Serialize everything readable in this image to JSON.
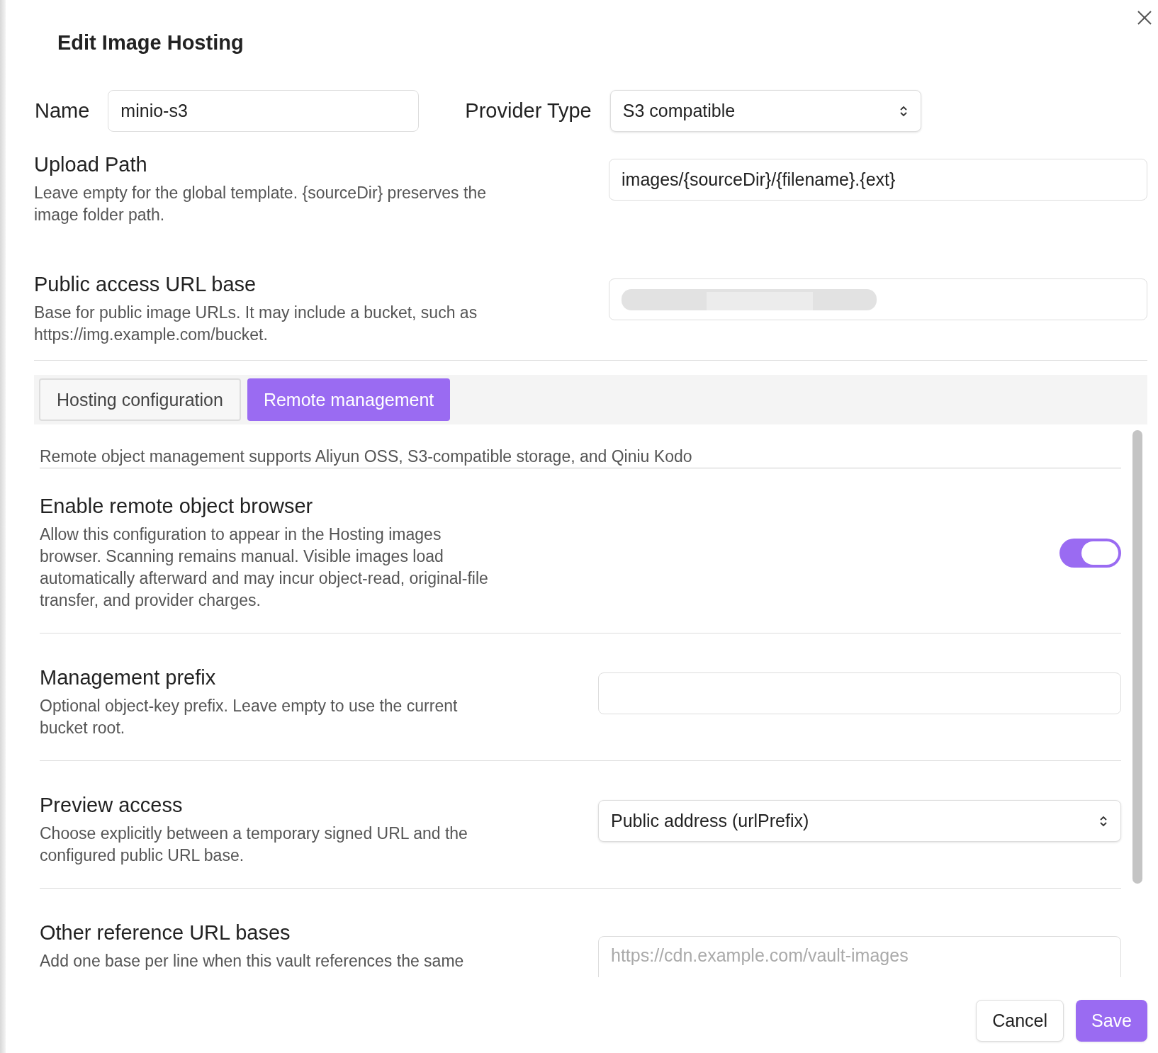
{
  "dialog": {
    "title": "Edit Image Hosting"
  },
  "name": {
    "label": "Name",
    "value": "minio-s3"
  },
  "provider_type": {
    "label": "Provider Type",
    "value": "S3 compatible"
  },
  "fields": [
    {
      "label": "Upload Path",
      "description": "Leave empty for the global template. {sourceDir} preserves the image folder path.",
      "value": "images/{sourceDir}/{filename}.{ext}"
    },
    {
      "label": "Public access URL base",
      "description": "Base for public image URLs. It may include a bucket, such as https://img.example.com/bucket.",
      "redacted": true
    }
  ],
  "tabs": [
    {
      "label": "Hosting configuration",
      "selected": false
    },
    {
      "label": "Remote management",
      "selected": true
    }
  ],
  "remote": {
    "note": "Remote object management supports Aliyun OSS, S3-compatible storage, and Qiniu Kodo",
    "settings": [
      {
        "kind": "toggle",
        "title": "Enable remote object browser",
        "description": "Allow this configuration to appear in the Hosting images browser. Scanning remains manual. Visible images load automatically afterward and may incur object-read, original-file transfer, and provider charges.",
        "on": true
      },
      {
        "kind": "input",
        "title": "Management prefix",
        "description": "Optional object-key prefix. Leave empty to use the current bucket root."
      },
      {
        "kind": "select",
        "title": "Preview access",
        "description": "Choose explicitly between a temporary signed URL and the configured public URL base.",
        "value": "Public address (urlPrefix)"
      },
      {
        "kind": "textarea",
        "title": "Other reference URL bases",
        "description": "Add one base per line when this vault references the same",
        "placeholder": "https://cdn.example.com/vault-images"
      }
    ]
  },
  "buttons": [
    {
      "label": "Cancel",
      "kind": "secondary"
    },
    {
      "label": "Save",
      "kind": "primary"
    }
  ]
}
